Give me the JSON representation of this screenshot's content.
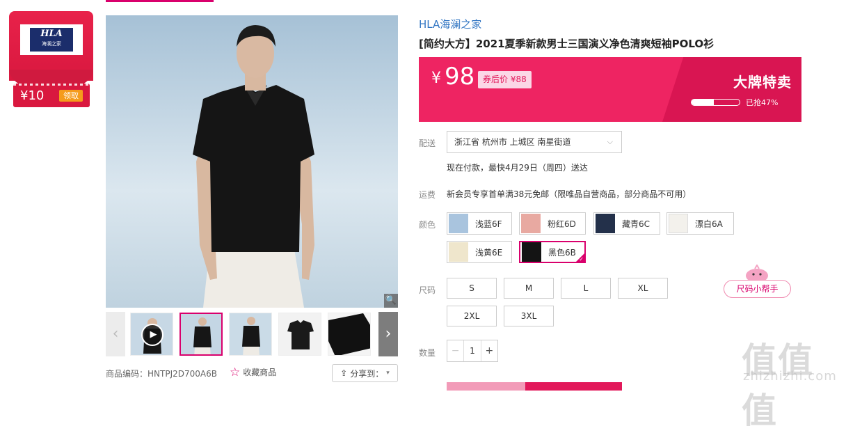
{
  "coupon": {
    "logo_text": "HLA",
    "logo_sub": "海澜之家",
    "amount": "¥10",
    "claim_label": "领取"
  },
  "gallery": {
    "sku_code": "商品编码：HNTPJ2D700A6B",
    "favorite_label": "收藏商品",
    "share_label": "分享到：",
    "thumb_count": 5,
    "active_thumb": 1
  },
  "product": {
    "brand": "HLA海澜之家",
    "title": "[简约大方】2021夏季新款男士三国演义净色清爽短袖POLO衫",
    "currency": "¥",
    "price": "98",
    "coupon_price": "券后价 ¥88",
    "sale_label": "大牌特卖",
    "sold_text": "已抢47%",
    "sold_fraction": 0.47
  },
  "delivery": {
    "label": "配送",
    "address": "浙江省 杭州市 上城区 南星街道",
    "eta": "现在付款，最快4月29日（周四）送达"
  },
  "shipping": {
    "label": "运费",
    "text": "新会员专享首单满38元免邮（限唯品自营商品，部分商品不可用）"
  },
  "colors": {
    "label": "颜色",
    "options": [
      {
        "name": "浅蓝6F",
        "swatch": "#a9c4de"
      },
      {
        "name": "粉红6D",
        "swatch": "#e8a9a1"
      },
      {
        "name": "藏青6C",
        "swatch": "#23304a"
      },
      {
        "name": "漂白6A",
        "swatch": "#f3f1ec"
      },
      {
        "name": "浅黄6E",
        "swatch": "#efe6cc"
      },
      {
        "name": "黑色6B",
        "swatch": "#141414"
      }
    ],
    "selected": "黑色6B"
  },
  "sizes": {
    "label": "尺码",
    "options": [
      "S",
      "M",
      "L",
      "XL",
      "2XL",
      "3XL"
    ],
    "helper_label": "尺码小帮手"
  },
  "quantity": {
    "label": "数量",
    "value": "1",
    "minus": "−",
    "plus": "+"
  },
  "watermark": {
    "text": "值值值",
    "url": "zhizhizhi.com"
  },
  "colors_theme": {
    "accent": "#d9006c",
    "price_band": "#ee2462",
    "link": "#3276c3"
  }
}
